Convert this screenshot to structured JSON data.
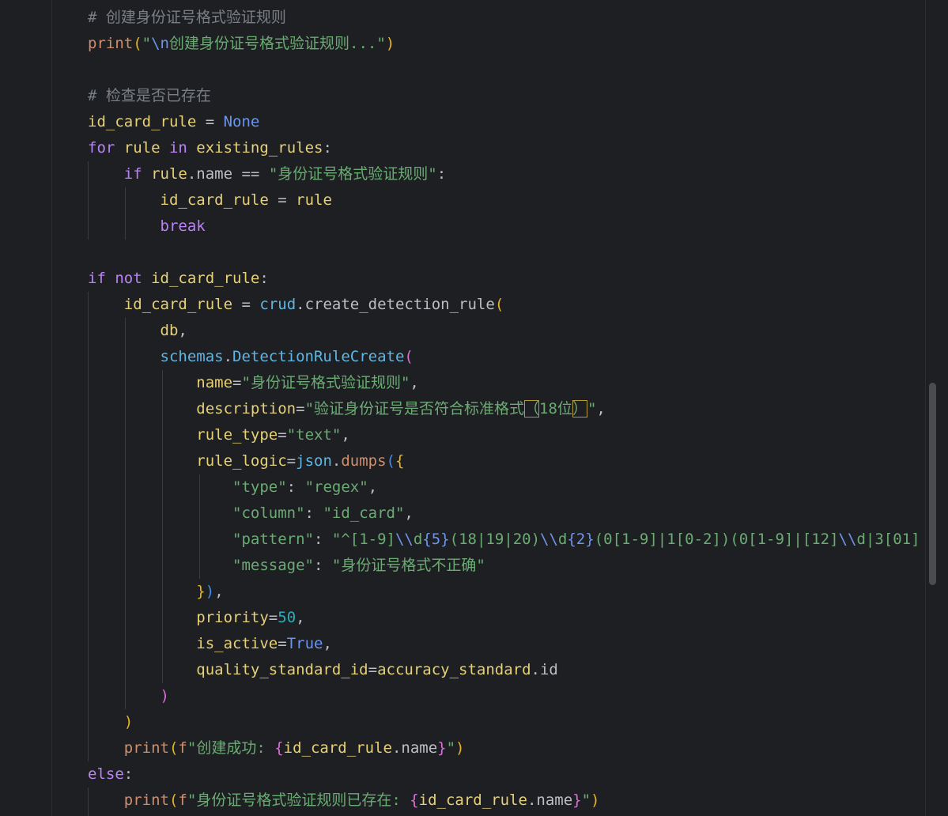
{
  "editor": {
    "lines": {
      "l1": "# 创建身份证号格式验证规则",
      "l2_fn": "print",
      "l2_open": "(",
      "l2_q1": "\"",
      "l2_esc": "\\n",
      "l2_text": "创建身份证号格式验证规则...\"",
      "l2_close": ")",
      "l4": "# 检查是否已存在",
      "l5_var": "id_card_rule",
      "l5_op": " = ",
      "l5_none": "None",
      "l6_for": "for",
      "l6_rule": " rule ",
      "l6_in": "in",
      "l6_existing": " existing_rules",
      "l6_colon": ":",
      "l7_if": "if",
      "l7_rule": " rule",
      "l7_name": ".name == ",
      "l7_str": "\"身份证号格式验证规则\"",
      "l7_colon": ":",
      "l8_var": "id_card_rule",
      "l8_rest": " = ",
      "l8_rule": "rule",
      "l9": "break",
      "l11_if": "if",
      "l11_not": " not",
      "l11_var": " id_card_rule",
      "l11_colon": ":",
      "l12_var": "id_card_rule",
      "l12_op": " = ",
      "l12_crud": "crud",
      "l12_fn": ".create_detection_rule",
      "l12_open": "(",
      "l13_db": "db",
      "l13_comma": ",",
      "l14_schemas": "schemas",
      "l14_dot": ".",
      "l14_cls": "DetectionRuleCreate",
      "l14_open": "(",
      "l15_kw": "name",
      "l15_eq": "=",
      "l15_str": "\"身份证号格式验证规则\"",
      "l15_comma": ",",
      "l16_kw": "description",
      "l16_eq": "=",
      "l16_str_a": "\"验证身份证号是否符合标准格式",
      "l16_paren_l": "（",
      "l16_str_b": "18位",
      "l16_paren_r": "）",
      "l16_str_c": "\"",
      "l16_comma": ",",
      "l17_kw": "rule_type",
      "l17_eq": "=",
      "l17_str": "\"text\"",
      "l17_comma": ",",
      "l18_kw": "rule_logic",
      "l18_eq": "=",
      "l18_json": "json",
      "l18_dot": ".",
      "l18_fn": "dumps",
      "l18_open": "(",
      "l18_brace": "{",
      "l19_key": "\"type\"",
      "l19_colon": ": ",
      "l19_val": "\"regex\"",
      "l19_comma": ",",
      "l20_key": "\"column\"",
      "l20_colon": ": ",
      "l20_val": "\"id_card\"",
      "l20_comma": ",",
      "l21_key": "\"pattern\"",
      "l21_colon": ": ",
      "l21_s1": "\"^[1-9]",
      "l21_e1": "\\\\",
      "l21_s2": "d",
      "l21_b1": "{5}",
      "l21_s3": "(18|19|20)",
      "l21_e2": "\\\\",
      "l21_s4": "d",
      "l21_b2": "{2}",
      "l21_s5": "(0[1-9]|1[0-2])(0[1-9]|[12]",
      "l21_e3": "\\\\",
      "l21_s6": "d|3[01]",
      "l22_key": "\"message\"",
      "l22_colon": ": ",
      "l22_val": "\"身份证号格式不正确\"",
      "l23_brace": "}",
      "l23_paren": ")",
      "l23_comma": ",",
      "l24_kw": "priority",
      "l24_eq": "=",
      "l24_num": "50",
      "l24_comma": ",",
      "l25_kw": "is_active",
      "l25_eq": "=",
      "l25_val": "True",
      "l25_comma": ",",
      "l26_kw": "quality_standard_id",
      "l26_eq": "=",
      "l26_var": "accuracy_standard",
      "l26_attr": ".id",
      "l27": ")",
      "l28": ")",
      "l29_fn": "print",
      "l29_open": "(",
      "l29_f": "f",
      "l29_str": "\"创建成功: ",
      "l29_lb": "{",
      "l29_var": "id_card_rule",
      "l29_attr": ".name",
      "l29_rb": "}",
      "l29_q": "\"",
      "l29_close": ")",
      "l30_else": "else",
      "l30_colon": ":",
      "l31_fn": "print",
      "l31_open": "(",
      "l31_f": "f",
      "l31_str": "\"身份证号格式验证规则已存在: ",
      "l31_lb": "{",
      "l31_var": "id_card_rule",
      "l31_attr": ".name",
      "l31_rb": "}",
      "l31_q": "\"",
      "l31_close": ")"
    }
  }
}
